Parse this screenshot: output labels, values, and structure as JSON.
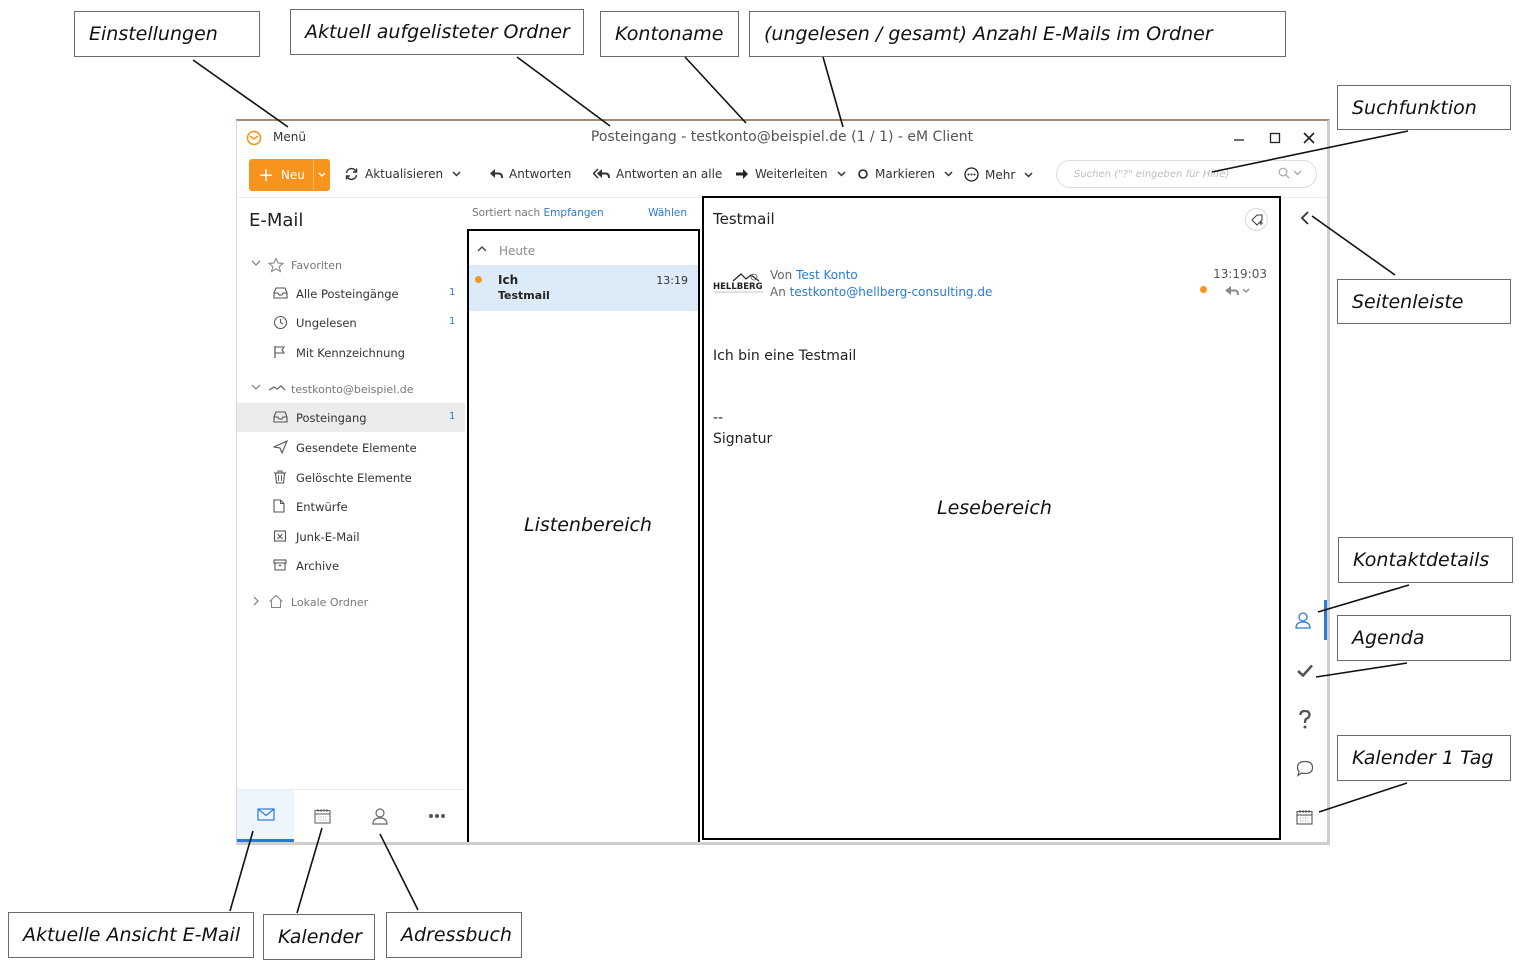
{
  "window": {
    "menu_label": "Menü",
    "title": "Posteingang - testkonto@beispiel.de (1 / 1) - eM Client"
  },
  "toolbar": {
    "new_label": "Neu",
    "refresh_label": "Aktualisieren",
    "reply_label": "Antworten",
    "reply_all_label": "Antworten an alle",
    "forward_label": "Weiterleiten",
    "mark_label": "Markieren",
    "more_label": "Mehr",
    "search_placeholder": "Suchen (\"?\" eingeben für Hilfe)"
  },
  "sidebar": {
    "title": "E-Mail",
    "favorites_label": "Favoriten",
    "favorites": [
      {
        "label": "Alle Posteingänge",
        "count": "1"
      },
      {
        "label": "Ungelesen",
        "count": "1"
      },
      {
        "label": "Mit Kennzeichnung",
        "count": ""
      }
    ],
    "account_label": "testkonto@beispiel.de",
    "folders": [
      {
        "label": "Posteingang",
        "count": "1"
      },
      {
        "label": "Gesendete Elemente",
        "count": ""
      },
      {
        "label": "Gelöschte Elemente",
        "count": ""
      },
      {
        "label": "Entwürfe",
        "count": ""
      },
      {
        "label": "Junk-E-Mail",
        "count": ""
      },
      {
        "label": "Archive",
        "count": ""
      }
    ],
    "local_label": "Lokale Ordner"
  },
  "list": {
    "sort_prefix": "Sortiert nach",
    "sort_value": "Empfangen",
    "choose_label": "Wählen",
    "group_label": "Heute",
    "message": {
      "from": "Ich",
      "subject": "Testmail",
      "time": "13:19"
    }
  },
  "reading": {
    "subject": "Testmail",
    "from_prefix": "Von",
    "from_name": "Test Konto",
    "to_prefix": "An",
    "to_address": "testkonto@hellberg-consulting.de",
    "time": "13:19:03",
    "body": "Ich bin eine Testmail",
    "sig_separator": "--",
    "signature": "Signatur",
    "sender_logo_text": "HELLBERG"
  },
  "zones": {
    "list": "Listenbereich",
    "reading": "Lesebereich"
  },
  "callouts": {
    "settings": "Einstellungen",
    "folder": "Aktuell aufgelisteter Ordner",
    "account": "Kontoname",
    "count": "(ungelesen / gesamt) Anzahl E-Mails im Ordner",
    "search": "Suchfunktion",
    "sidebar": "Seitenleiste",
    "contact": "Kontaktdetails",
    "agenda": "Agenda",
    "calendar_day": "Kalender 1 Tag",
    "mail_view": "Aktuelle Ansicht E-Mail",
    "calendar": "Kalender",
    "addressbook": "Adressbuch"
  },
  "colors": {
    "accent": "#f7941d",
    "link": "#2a7bd5",
    "selection": "#ddeaf8"
  }
}
